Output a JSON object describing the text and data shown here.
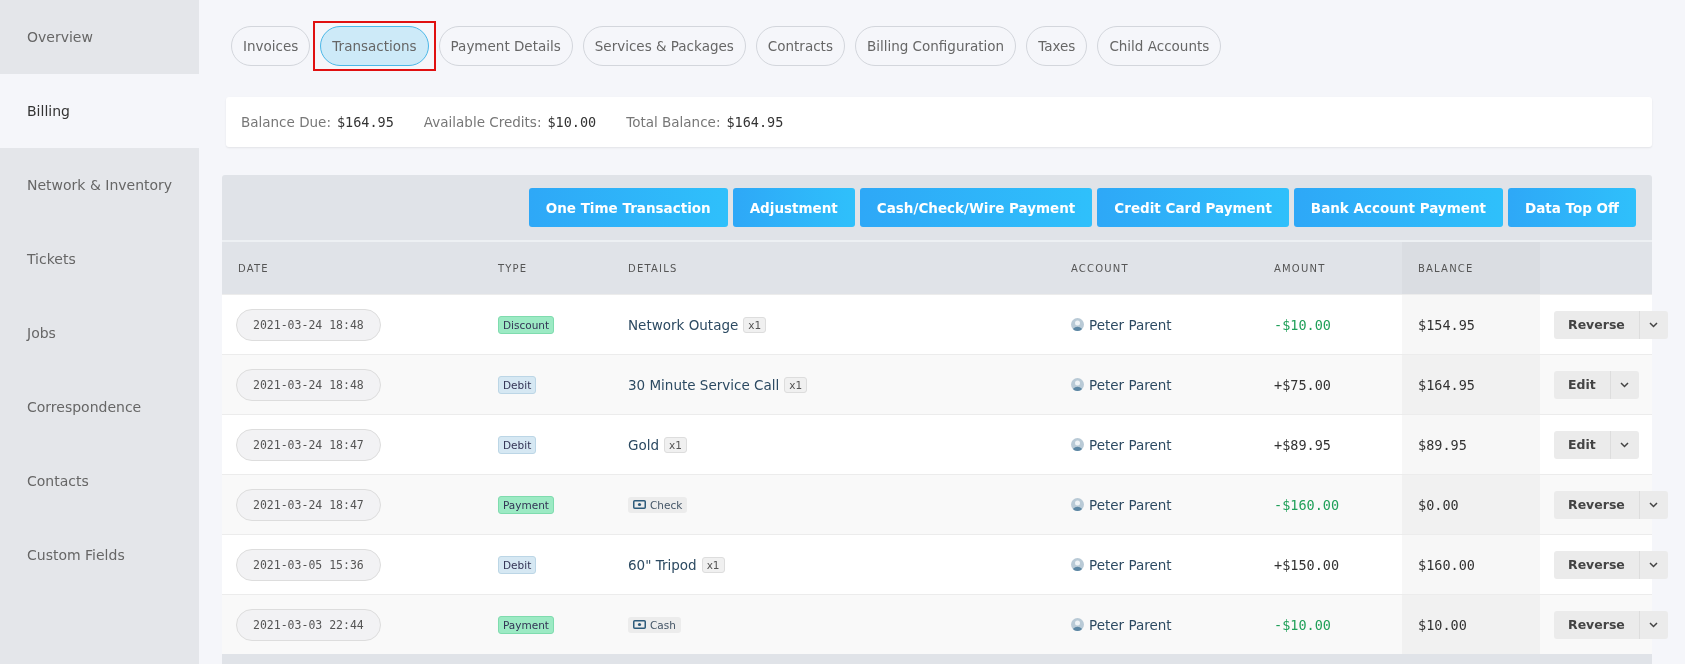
{
  "sidebar": {
    "items": [
      {
        "label": "Overview",
        "selected": false
      },
      {
        "label": "Billing",
        "selected": true
      },
      {
        "label": "Network & Inventory",
        "selected": false
      },
      {
        "label": "Tickets",
        "selected": false
      },
      {
        "label": "Jobs",
        "selected": false
      },
      {
        "label": "Correspondence",
        "selected": false
      },
      {
        "label": "Contacts",
        "selected": false
      },
      {
        "label": "Custom Fields",
        "selected": false
      }
    ]
  },
  "tabs": [
    {
      "label": "Invoices",
      "selected": false,
      "annotated": false
    },
    {
      "label": "Transactions",
      "selected": true,
      "annotated": true
    },
    {
      "label": "Payment Details",
      "selected": false,
      "annotated": false
    },
    {
      "label": "Services & Packages",
      "selected": false,
      "annotated": false
    },
    {
      "label": "Contracts",
      "selected": false,
      "annotated": false
    },
    {
      "label": "Billing Configuration",
      "selected": false,
      "annotated": false
    },
    {
      "label": "Taxes",
      "selected": false,
      "annotated": false
    },
    {
      "label": "Child Accounts",
      "selected": false,
      "annotated": false
    }
  ],
  "summary": [
    {
      "label": "Balance Due:",
      "value": "$164.95"
    },
    {
      "label": "Available Credits:",
      "value": "$10.00"
    },
    {
      "label": "Total Balance:",
      "value": "$164.95"
    }
  ],
  "actions": [
    "One Time Transaction",
    "Adjustment",
    "Cash/Check/Wire Payment",
    "Credit Card Payment",
    "Bank Account Payment",
    "Data Top Off"
  ],
  "table": {
    "columns": [
      "DATE",
      "TYPE",
      "DETAILS",
      "ACCOUNT",
      "AMOUNT",
      "BALANCE"
    ],
    "rows": [
      {
        "date": "2021-03-24 18:48",
        "type": "Discount",
        "kind": "credit",
        "details": {
          "kind": "item",
          "text": "Network Outage",
          "qty": "x1"
        },
        "account": "Peter Parent",
        "amount": "-$10.00",
        "balance": "$154.95",
        "action": "Reverse"
      },
      {
        "date": "2021-03-24 18:48",
        "type": "Debit",
        "kind": "debit",
        "details": {
          "kind": "item",
          "text": "30 Minute Service Call",
          "qty": "x1"
        },
        "account": "Peter Parent",
        "amount": "+$75.00",
        "balance": "$164.95",
        "action": "Edit"
      },
      {
        "date": "2021-03-24 18:47",
        "type": "Debit",
        "kind": "debit",
        "details": {
          "kind": "item",
          "text": "Gold",
          "qty": "x1"
        },
        "account": "Peter Parent",
        "amount": "+$89.95",
        "balance": "$89.95",
        "action": "Edit"
      },
      {
        "date": "2021-03-24 18:47",
        "type": "Payment",
        "kind": "credit",
        "details": {
          "kind": "payment",
          "text": "Check"
        },
        "account": "Peter Parent",
        "amount": "-$160.00",
        "balance": "$0.00",
        "action": "Reverse"
      },
      {
        "date": "2021-03-05 15:36",
        "type": "Debit",
        "kind": "debit",
        "details": {
          "kind": "item",
          "text": "60\" Tripod",
          "qty": "x1"
        },
        "account": "Peter Parent",
        "amount": "+$150.00",
        "balance": "$160.00",
        "action": "Reverse"
      },
      {
        "date": "2021-03-03 22:44",
        "type": "Payment",
        "kind": "credit",
        "details": {
          "kind": "payment",
          "text": "Cash"
        },
        "account": "Peter Parent",
        "amount": "-$10.00",
        "balance": "$10.00",
        "action": "Reverse"
      }
    ]
  }
}
